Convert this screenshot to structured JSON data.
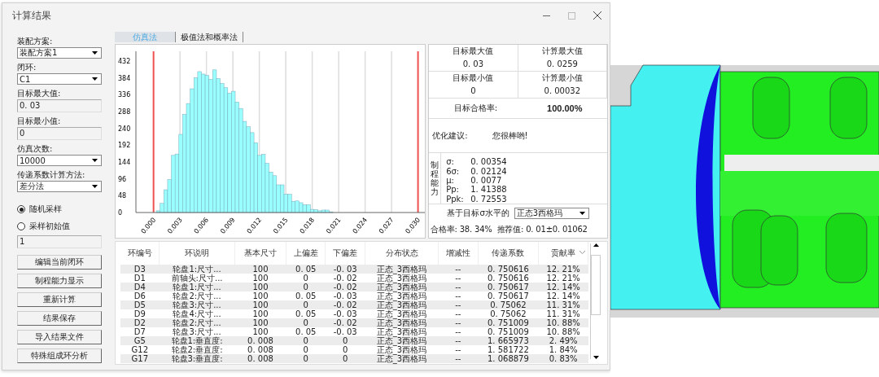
{
  "window": {
    "title": "计算结果"
  },
  "left_panel": {
    "fields": [
      {
        "kind": "select",
        "label": "装配方案:",
        "value": "装配方案1"
      },
      {
        "kind": "select",
        "label": "闭环:",
        "value": "C1"
      },
      {
        "kind": "input",
        "label": "目标最大值:",
        "value": "0. 03"
      },
      {
        "kind": "input",
        "label": "目标最小值:",
        "value": "0"
      },
      {
        "kind": "select",
        "label": "仿真次数:",
        "value": "10000"
      },
      {
        "kind": "select",
        "label": "传递系数计算方法:",
        "value": "差分法"
      }
    ],
    "radios": [
      {
        "label": "随机采样",
        "selected": true
      },
      {
        "label": "采样初始值",
        "selected": false
      }
    ],
    "seed_input": {
      "value": "1"
    },
    "buttons": [
      "编辑当前闭环",
      "制程能力显示",
      "重新计算",
      "结果保存",
      "导入结果文件",
      "特殊组成环分析"
    ]
  },
  "tabs": [
    {
      "label": "仿真法",
      "selected": true
    },
    {
      "label": "极值法和概率法",
      "selected": false
    }
  ],
  "chart_data": {
    "type": "bar",
    "xlim": [
      -0.002,
      0.0317
    ],
    "ylim": [
      0,
      460
    ],
    "yticks": [
      0,
      48,
      96,
      144,
      192,
      240,
      288,
      336,
      384,
      432
    ],
    "xticks": [
      {
        "value": 0,
        "label": "0.000"
      },
      {
        "value": 0.003,
        "label": "0.003"
      },
      {
        "value": 0.006,
        "label": "0.006"
      },
      {
        "value": 0.009,
        "label": "0.009"
      },
      {
        "value": 0.012,
        "label": "0.012"
      },
      {
        "value": 0.015,
        "label": "0.015"
      },
      {
        "value": 0.018,
        "label": "0.018"
      },
      {
        "value": 0.021,
        "label": "0.021"
      },
      {
        "value": 0.024,
        "label": "0.024"
      },
      {
        "value": 0.027,
        "label": "0.027"
      },
      {
        "value": 0.03,
        "label": "0.030"
      }
    ],
    "x": [
      0.00053,
      0.00096,
      0.00138,
      0.00181,
      0.00224,
      0.00266,
      0.00309,
      0.00351,
      0.00394,
      0.00437,
      0.00479,
      0.00522,
      0.00564,
      0.00607,
      0.0065,
      0.00692,
      0.00735,
      0.00777,
      0.0082,
      0.00863,
      0.00905,
      0.00948,
      0.0099,
      0.01033,
      0.01076,
      0.01118,
      0.01161,
      0.01203,
      0.01246,
      0.01289,
      0.01331,
      0.01374,
      0.01416,
      0.01459,
      0.01502,
      0.01544,
      0.01587,
      0.01629,
      0.01672,
      0.01715,
      0.01757,
      0.018,
      0.01842,
      0.01885,
      0.01928,
      0.0197,
      0.02013,
      0.02055,
      0.02098,
      0.02141,
      0.02183,
      0.02226,
      0.02268,
      0.02311,
      0.02354,
      0.02396,
      0.02439,
      0.02481,
      0.02524,
      0.02567
    ],
    "values": [
      5,
      26,
      65,
      94,
      163,
      167,
      223,
      280,
      311,
      353,
      384,
      402,
      395,
      391,
      380,
      407,
      382,
      368,
      356,
      340,
      346,
      315,
      297,
      260,
      245,
      228,
      199,
      163,
      166,
      140,
      115,
      105,
      79,
      79,
      52,
      52,
      32,
      33,
      28,
      22,
      22,
      9,
      8,
      5,
      7,
      7,
      2,
      null,
      0,
      null,
      null,
      0,
      0,
      null,
      0,
      0,
      0,
      null,
      0,
      0
    ],
    "grid": true,
    "ref_lines": [
      {
        "axis": "x",
        "value": 0
      },
      {
        "axis": "x",
        "value": 0.03
      }
    ]
  },
  "summary": {
    "cells": [
      {
        "label": "目标最大值",
        "value": "0. 03"
      },
      {
        "label": "计算最大值",
        "value": "0. 0259"
      },
      {
        "label": "目标最小值",
        "value": "0"
      },
      {
        "label": "计算最小值",
        "value": "0. 00032"
      }
    ],
    "pass_rate": {
      "label": "目标合格率:",
      "value": "100.00%"
    },
    "advice": {
      "label": "优化建议:",
      "value": "您很棒哟!"
    },
    "capability": {
      "title": "制程能力",
      "rows": [
        {
          "name": "σ:",
          "value": "0. 00354"
        },
        {
          "name": "6σ:",
          "value": "0. 02124"
        },
        {
          "name": "μ:",
          "value": "0. 0077"
        },
        {
          "name": "Pp:",
          "value": "1. 41388"
        },
        {
          "name": "Ppk:",
          "value": "0. 72553"
        }
      ]
    },
    "sigma": {
      "label": "基于目标σ水平的",
      "value": "正态3西格玛"
    },
    "result": [
      {
        "label": "合格率:",
        "value": "38. 34%"
      },
      {
        "label": "推荐值:",
        "value": "0. 01±0. 01062"
      }
    ]
  },
  "table": {
    "columns": [
      "环编号",
      "环说明",
      "基本尺寸",
      "上偏差",
      "下偏差",
      "分布状态",
      "增减性",
      "传递系数",
      "贡献率"
    ],
    "rows": [
      [
        "D3",
        "轮盘1:尺寸...",
        "100",
        "0. 05",
        "-0. 03",
        "正态_3西格玛",
        "--",
        "0. 750616",
        "12. 21%"
      ],
      [
        "D1",
        "前轴头:尺寸...",
        "100",
        "0",
        "-0. 02",
        "正态_3西格玛",
        "--",
        "0. 750616",
        "12. 21%"
      ],
      [
        "D4",
        "轮盘1:尺寸...",
        "100",
        "0",
        "-0. 02",
        "正态_3西格玛",
        "--",
        "0. 750617",
        "12. 14%"
      ],
      [
        "D6",
        "轮盘2:尺寸...",
        "100",
        "0. 05",
        "-0. 03",
        "正态_3西格玛",
        "--",
        "0. 750617",
        "12. 14%"
      ],
      [
        "D5",
        "轮盘3:尺寸...",
        "100",
        "0",
        "-0. 02",
        "正态_3西格玛",
        "--",
        "0. 75062",
        "11. 31%"
      ],
      [
        "D9",
        "轮盘4:尺寸...",
        "100",
        "0. 05",
        "-0. 03",
        "正态_3西格玛",
        "--",
        "0. 75062",
        "11. 31%"
      ],
      [
        "D2",
        "轮盘2:尺寸...",
        "100",
        "0",
        "-0. 02",
        "正态_3西格玛",
        "--",
        "0. 751009",
        "10. 88%"
      ],
      [
        "D7",
        "轮盘3:尺寸...",
        "100",
        "0. 05",
        "-0. 03",
        "正态_3西格玛",
        "--",
        "0. 751009",
        "10. 88%"
      ],
      [
        "G5",
        "轮盘1:垂直度:",
        "0. 008",
        "0",
        "0",
        "正态_3西格玛",
        "--",
        "1. 665973",
        "2. 49%"
      ],
      [
        "G12",
        "轮盘2:垂直度:",
        "0. 008",
        "0",
        "0",
        "正态_3西格玛",
        "--",
        "1. 581722",
        "1. 84%"
      ],
      [
        "G17",
        "轮盘3:垂直度:",
        "0. 008",
        "0",
        "0",
        "正态_3西格玛",
        "--",
        "1. 068879",
        "0. 83%"
      ]
    ]
  }
}
